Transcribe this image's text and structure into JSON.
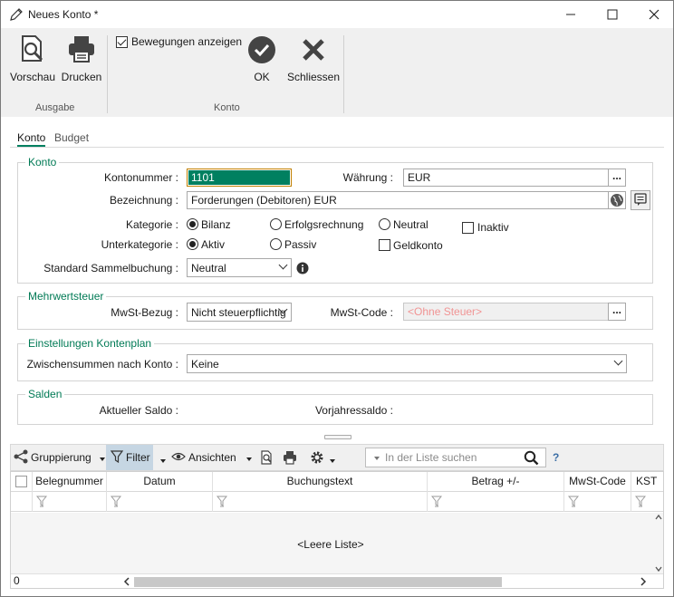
{
  "window": {
    "title": "Neues Konto *"
  },
  "ribbon": {
    "vorschau_label": "Vorschau",
    "drucken_label": "Drucken",
    "ausgabe_group": "Ausgabe",
    "bewegungen_label": "Bewegungen anzeigen",
    "bewegungen_checked": true,
    "ok_label": "OK",
    "schliessen_label": "Schliessen",
    "konto_group": "Konto"
  },
  "tabs": {
    "konto": "Konto",
    "budget": "Budget",
    "active": "Konto"
  },
  "konto_group": {
    "title": "Konto",
    "kontonummer_label": "Kontonummer :",
    "kontonummer_value": "1101",
    "waehrung_label": "Währung :",
    "waehrung_value": "EUR",
    "bezeichnung_label": "Bezeichnung :",
    "bezeichnung_value": "Forderungen (Debitoren) EUR",
    "kategorie_label": "Kategorie :",
    "kategorie_options": [
      "Bilanz",
      "Erfolgsrechnung",
      "Neutral"
    ],
    "kategorie_selected": "Bilanz",
    "inaktiv_label": "Inaktiv",
    "unterkategorie_label": "Unterkategorie :",
    "unterkategorie_options": [
      "Aktiv",
      "Passiv"
    ],
    "unterkategorie_selected": "Aktiv",
    "geldkonto_label": "Geldkonto",
    "sammelbuchung_label": "Standard Sammelbuchung :",
    "sammelbuchung_value": "Neutral",
    "dots": "..."
  },
  "mwst_group": {
    "title": "Mehrwertsteuer",
    "bezug_label": "MwSt-Bezug :",
    "bezug_value": "Nicht steuerpflichtig",
    "code_label": "MwSt-Code :",
    "code_placeholder": "<Ohne Steuer>"
  },
  "kontenplan_group": {
    "title": "Einstellungen Kontenplan",
    "zwischensummen_label": "Zwischensummen nach Konto :",
    "zwischensummen_value": "Keine"
  },
  "salden_group": {
    "title": "Salden",
    "aktueller_label": "Aktueller Saldo :",
    "vorjahr_label": "Vorjahressaldo :"
  },
  "grid_toolbar": {
    "gruppierung": "Gruppierung",
    "filter": "Filter",
    "ansichten": "Ansichten",
    "search_placeholder": "In der Liste suchen",
    "help": "?"
  },
  "grid": {
    "columns": [
      "Belegnummer",
      "Datum",
      "Buchungstext",
      "Betrag +/-",
      "MwSt-Code",
      "KST"
    ],
    "empty_text": "<Leere Liste>",
    "row_count": "0"
  },
  "colors": {
    "accent": "#007a55",
    "input_highlight": "#008060",
    "disabled_text": "#f19494"
  }
}
